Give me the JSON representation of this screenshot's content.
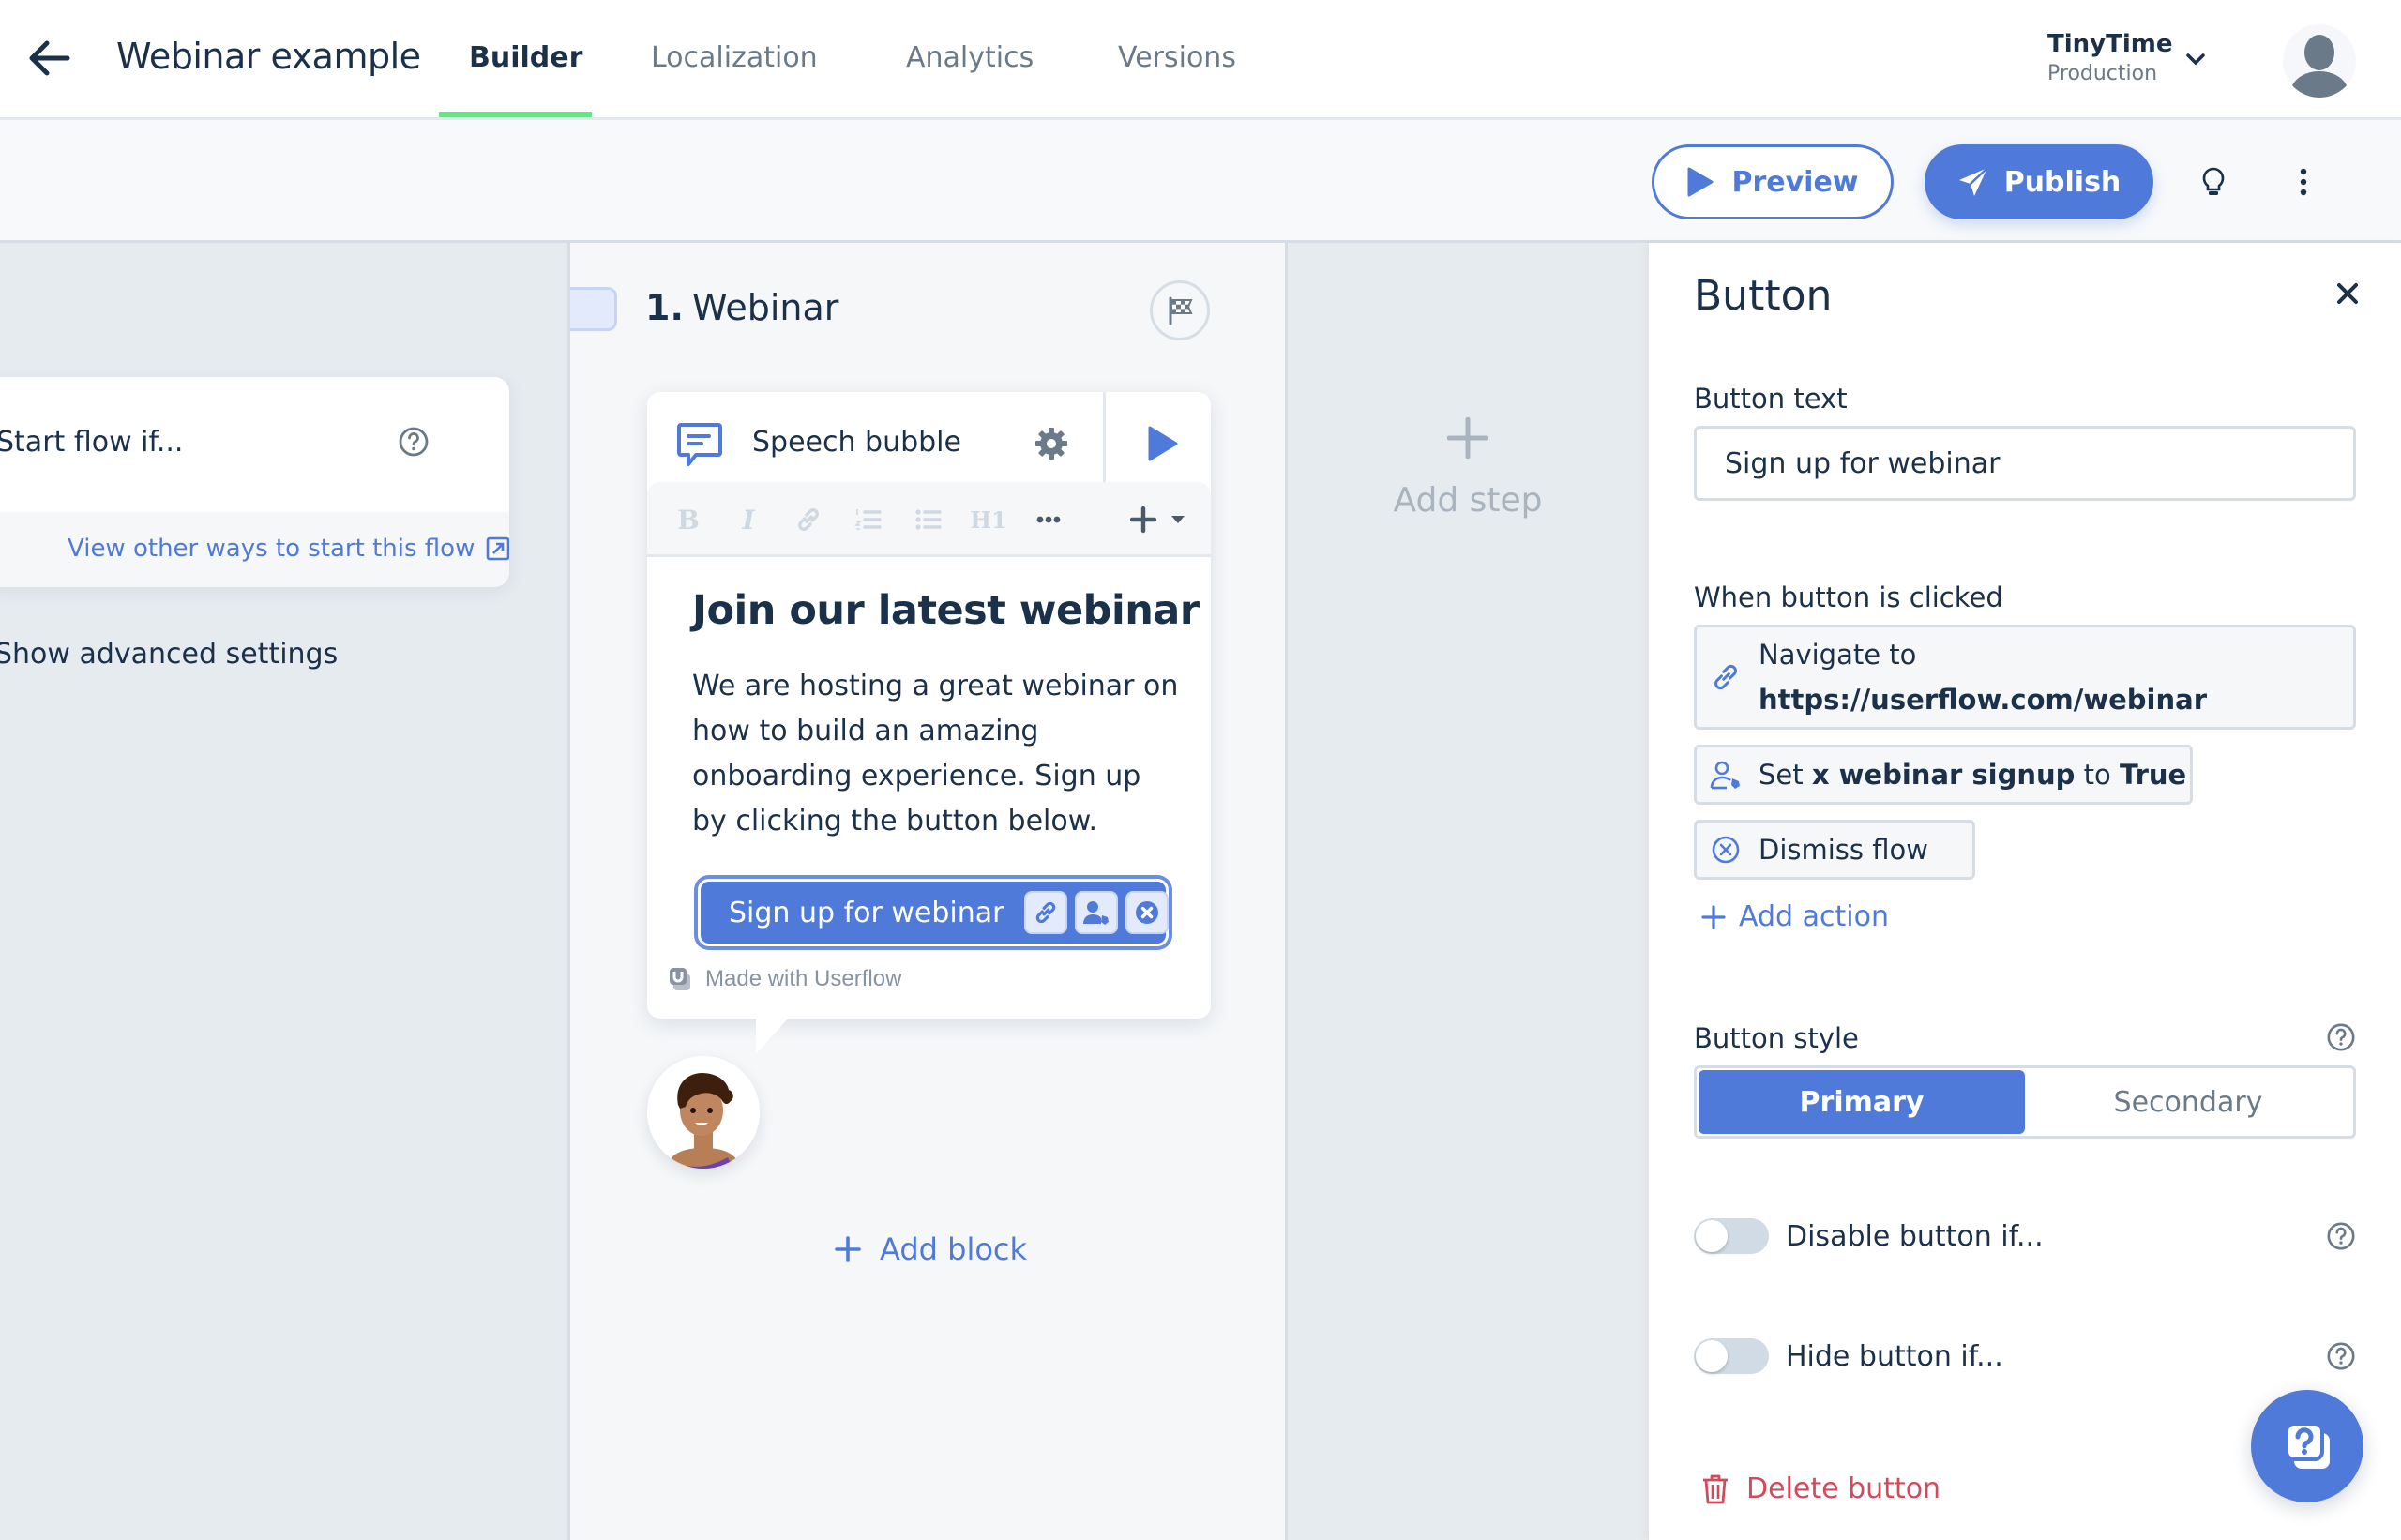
{
  "header": {
    "back_label": "Back",
    "flow_title": "Webinar example",
    "tabs": [
      {
        "label": "Builder",
        "active": true
      },
      {
        "label": "Localization",
        "active": false
      },
      {
        "label": "Analytics",
        "active": false
      },
      {
        "label": "Versions",
        "active": false
      }
    ],
    "org": {
      "name": "TinyTime",
      "environment": "Production"
    }
  },
  "toolbar": {
    "preview_label": "Preview",
    "publish_label": "Publish"
  },
  "left_panel": {
    "trigger_label": "Start flow if...",
    "view_ways_link": "View other ways to start this flow",
    "advanced_settings": "Show advanced settings"
  },
  "step": {
    "number": "1.",
    "name": "Webinar",
    "block": {
      "type_label": "Speech bubble",
      "editor_tools": [
        "bold",
        "italic",
        "link",
        "ordered-list",
        "bullet-list",
        "heading-1",
        "more",
        "insert"
      ],
      "heading_tool_label": "H1",
      "heading": "Join our latest webinar",
      "body": "We are hosting a great webinar on how to build an amazing onboarding experience. Sign up by clicking the button below.",
      "cta_label": "Sign up for webinar",
      "made_with": "Made with Userflow"
    },
    "add_block_label": "Add block"
  },
  "add_step_label": "Add step",
  "right_panel": {
    "title": "Button",
    "button_text_label": "Button text",
    "button_text_value": "Sign up for webinar",
    "when_clicked_label": "When button is clicked",
    "actions": {
      "navigate": {
        "prefix": "Navigate to",
        "url": "https://userflow.com/webinar"
      },
      "set_attribute": {
        "verb": "Set",
        "attribute": "x webinar signup",
        "connector": "to",
        "value": "True"
      },
      "dismiss": {
        "label": "Dismiss flow"
      }
    },
    "add_action_label": "Add action",
    "button_style_label": "Button style",
    "style_options": [
      {
        "label": "Primary",
        "selected": true
      },
      {
        "label": "Secondary",
        "selected": false
      }
    ],
    "disable_toggle": {
      "label": "Disable button if...",
      "on": false
    },
    "hide_toggle": {
      "label": "Hide button if...",
      "on": false
    },
    "delete_label": "Delete button"
  },
  "colors": {
    "accent": "#507ad9",
    "active_tab_underline": "#6ee08c",
    "danger": "#d24a5c",
    "text": "#1b3049",
    "muted": "#6b7a89"
  }
}
